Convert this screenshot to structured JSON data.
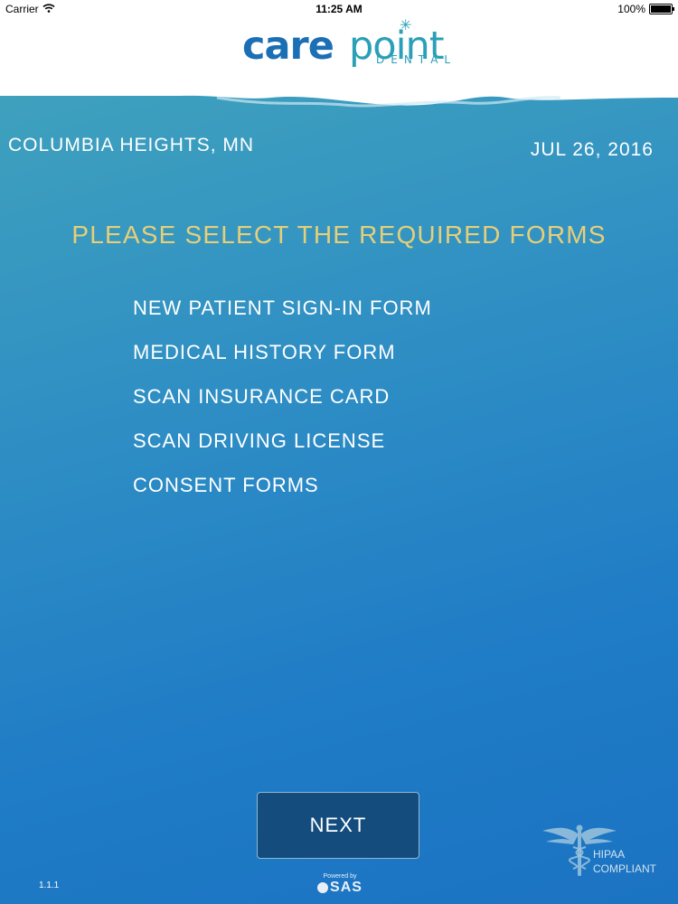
{
  "status_bar": {
    "carrier": "Carrier",
    "time": "11:25 AM",
    "battery": "100%"
  },
  "brand": {
    "name_part1": "care",
    "name_part2": "point",
    "tagline": "DENTAL",
    "colors": {
      "primary": "#1a6fb5",
      "secondary": "#2aa0b8"
    }
  },
  "location": "COLUMBIA HEIGHTS, MN",
  "date": "JUL 26, 2016",
  "heading": "PLEASE SELECT THE REQUIRED FORMS",
  "forms": [
    "NEW PATIENT SIGN-IN FORM",
    "MEDICAL HISTORY FORM",
    "SCAN INSURANCE CARD",
    "SCAN DRIVING LICENSE",
    "CONSENT FORMS"
  ],
  "next_button": "NEXT",
  "version": "1.1.1",
  "powered_by": {
    "label": "Powered by",
    "brand": "SAS"
  },
  "hipaa": {
    "line1": "HIPAA",
    "line2": "COMPLIANT"
  },
  "colors": {
    "heading": "#e6cf78",
    "background_top": "#3fa1bd",
    "background_bottom": "#1b73c2",
    "button": "#134c7d"
  }
}
